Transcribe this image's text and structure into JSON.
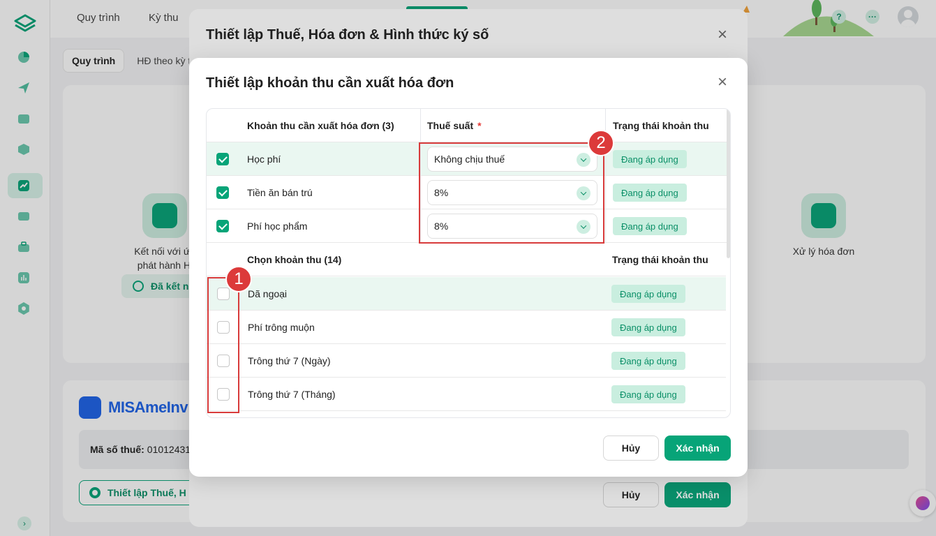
{
  "topbar": {
    "nav": [
      "Quy trình",
      "Kỳ thu"
    ]
  },
  "subtabs": [
    "Quy trình",
    "HĐ theo kỳ t"
  ],
  "background": {
    "step_left_text": [
      "Kết nối với ứng",
      "phát hành HĐ"
    ],
    "connected_label": "Đã kết n",
    "step_right_text": "Xử lý hóa đơn",
    "brand": "MISAmeInv",
    "tax_label": "Mã số thuế:",
    "tax_value": "01012431",
    "settings_button": "Thiết lập Thuế, H"
  },
  "parent_modal": {
    "title": "Thiết lập Thuế, Hóa đơn & Hình thức ký số",
    "cancel": "Hủy",
    "confirm": "Xác nhận"
  },
  "modal": {
    "title": "Thiết lập khoản thu cần xuất hóa đơn",
    "selected_header": "Khoản thu cần xuất hóa đơn (3)",
    "tax_header": "Thuế suất",
    "required_mark": "*",
    "status_header": "Trạng thái khoản thu",
    "selected_items": [
      {
        "name": "Học phí",
        "tax": "Không chịu thuế",
        "status": "Đang áp dụng"
      },
      {
        "name": "Tiền ăn bán trú",
        "tax": "8%",
        "status": "Đang áp dụng"
      },
      {
        "name": "Phí học phẩm",
        "tax": "8%",
        "status": "Đang áp dụng"
      }
    ],
    "choose_header": "Chọn khoản thu (14)",
    "choose_status_header": "Trạng thái khoản thu",
    "choose_items": [
      {
        "name": "Dã ngoại",
        "status": "Đang áp dụng"
      },
      {
        "name": "Phí trông muộn",
        "status": "Đang áp dụng"
      },
      {
        "name": "Trông thứ 7 (Ngày)",
        "status": "Đang áp dụng"
      },
      {
        "name": "Trông thứ 7 (Tháng)",
        "status": "Đang áp dụng"
      }
    ],
    "cancel": "Hủy",
    "confirm": "Xác nhận"
  },
  "annotations": {
    "marker_1": "1",
    "marker_2": "2",
    "color": "#dc3a3a"
  },
  "colors": {
    "accent": "#07a478",
    "badge_bg": "#c9eedf",
    "highlight_row": "#eaf7f1"
  }
}
